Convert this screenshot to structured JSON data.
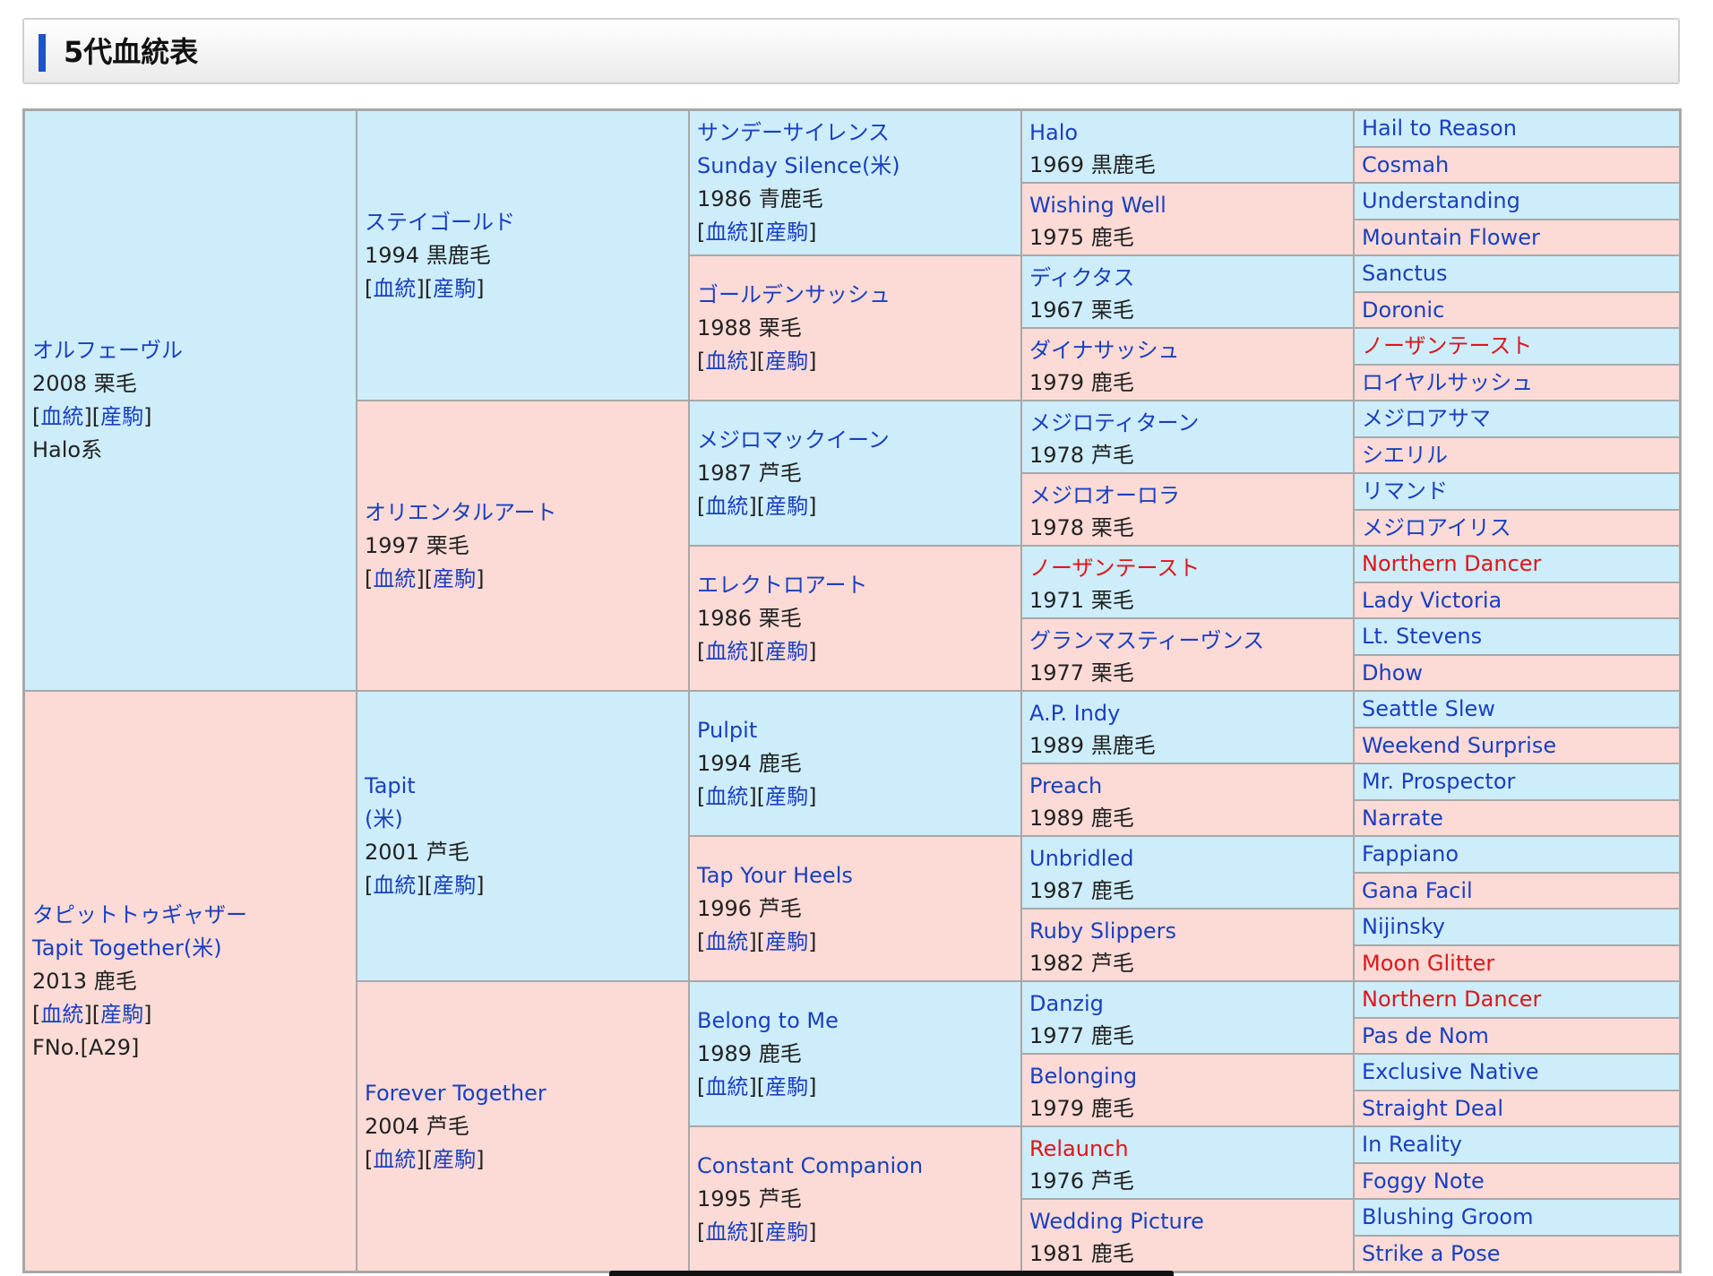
{
  "section": {
    "title": "5代血統表"
  },
  "link_labels": {
    "pedigree": "血統",
    "offspring": "産駒"
  },
  "gen1": [
    {
      "name": "オルフェーヴル",
      "info": "2008 栗毛",
      "extra": "Halo系",
      "sex": "m"
    },
    {
      "name": "タピットトゥギャザー",
      "alt": "Tapit Together(米)",
      "info": "2013 鹿毛",
      "extra": "FNo.[A29]",
      "sex": "f"
    }
  ],
  "gen2": [
    {
      "name": "ステイゴールド",
      "info": "1994 黒鹿毛",
      "sex": "m"
    },
    {
      "name": "オリエンタルアート",
      "info": "1997 栗毛",
      "sex": "f"
    },
    {
      "name": "Tapit",
      "alt": "(米)",
      "info": "2001 芦毛",
      "sex": "m"
    },
    {
      "name": "Forever Together",
      "info": "2004 芦毛",
      "sex": "f"
    }
  ],
  "gen3": [
    {
      "name": "サンデーサイレンス",
      "alt": "Sunday Silence(米)",
      "info": "1986 青鹿毛",
      "sex": "m"
    },
    {
      "name": "ゴールデンサッシュ",
      "info": "1988 栗毛",
      "sex": "f"
    },
    {
      "name": "メジロマックイーン",
      "info": "1987 芦毛",
      "sex": "m"
    },
    {
      "name": "エレクトロアート",
      "info": "1986 栗毛",
      "sex": "f"
    },
    {
      "name": "Pulpit",
      "info": "1994 鹿毛",
      "sex": "m"
    },
    {
      "name": "Tap Your Heels",
      "info": "1996 芦毛",
      "sex": "f"
    },
    {
      "name": "Belong to Me",
      "info": "1989 鹿毛",
      "sex": "m"
    },
    {
      "name": "Constant Companion",
      "info": "1995 芦毛",
      "sex": "f"
    }
  ],
  "gen4": [
    {
      "name": "Halo",
      "info": "1969 黒鹿毛",
      "sex": "m",
      "red": false
    },
    {
      "name": "Wishing Well",
      "info": "1975 鹿毛",
      "sex": "f",
      "red": false
    },
    {
      "name": "ディクタス",
      "info": "1967 栗毛",
      "sex": "m",
      "red": false
    },
    {
      "name": "ダイナサッシュ",
      "info": "1979 鹿毛",
      "sex": "f",
      "red": false
    },
    {
      "name": "メジロティターン",
      "info": "1978 芦毛",
      "sex": "m",
      "red": false
    },
    {
      "name": "メジロオーロラ",
      "info": "1978 栗毛",
      "sex": "f",
      "red": false
    },
    {
      "name": "ノーザンテースト",
      "info": "1971 栗毛",
      "sex": "m",
      "red": true
    },
    {
      "name": "グランマスティーヴンス",
      "info": "1977 栗毛",
      "sex": "f",
      "red": false
    },
    {
      "name": "A.P. Indy",
      "info": "1989 黒鹿毛",
      "sex": "m",
      "red": false
    },
    {
      "name": "Preach",
      "info": "1989 鹿毛",
      "sex": "f",
      "red": false
    },
    {
      "name": "Unbridled",
      "info": "1987 鹿毛",
      "sex": "m",
      "red": false
    },
    {
      "name": "Ruby Slippers",
      "info": "1982 芦毛",
      "sex": "f",
      "red": false
    },
    {
      "name": "Danzig",
      "info": "1977 鹿毛",
      "sex": "m",
      "red": false
    },
    {
      "name": "Belonging",
      "info": "1979 鹿毛",
      "sex": "f",
      "red": false
    },
    {
      "name": "Relaunch",
      "info": "1976 芦毛",
      "sex": "m",
      "red": true
    },
    {
      "name": "Wedding Picture",
      "info": "1981 鹿毛",
      "sex": "f",
      "red": false
    }
  ],
  "gen5": [
    {
      "name": "Hail to Reason",
      "red": false
    },
    {
      "name": "Cosmah",
      "red": false
    },
    {
      "name": "Understanding",
      "red": false
    },
    {
      "name": "Mountain Flower",
      "red": false
    },
    {
      "name": "Sanctus",
      "red": false
    },
    {
      "name": "Doronic",
      "red": false
    },
    {
      "name": "ノーザンテースト",
      "red": true
    },
    {
      "name": "ロイヤルサッシュ",
      "red": false
    },
    {
      "name": "メジロアサマ",
      "red": false
    },
    {
      "name": "シエリル",
      "red": false
    },
    {
      "name": "リマンド",
      "red": false
    },
    {
      "name": "メジロアイリス",
      "red": false
    },
    {
      "name": "Northern Dancer",
      "red": true
    },
    {
      "name": "Lady Victoria",
      "red": false
    },
    {
      "name": "Lt. Stevens",
      "red": false
    },
    {
      "name": "Dhow",
      "red": false
    },
    {
      "name": "Seattle Slew",
      "red": false
    },
    {
      "name": "Weekend Surprise",
      "red": false
    },
    {
      "name": "Mr. Prospector",
      "red": false
    },
    {
      "name": "Narrate",
      "red": false
    },
    {
      "name": "Fappiano",
      "red": false
    },
    {
      "name": "Gana Facil",
      "red": false
    },
    {
      "name": "Nijinsky",
      "red": false
    },
    {
      "name": "Moon Glitter",
      "red": true
    },
    {
      "name": "Northern Dancer",
      "red": true
    },
    {
      "name": "Pas de Nom",
      "red": false
    },
    {
      "name": "Exclusive Native",
      "red": false
    },
    {
      "name": "Straight Deal",
      "red": false
    },
    {
      "name": "In Reality",
      "red": false
    },
    {
      "name": "Foggy Note",
      "red": false
    },
    {
      "name": "Blushing Groom",
      "red": false
    },
    {
      "name": "Strike a Pose",
      "red": false
    }
  ]
}
